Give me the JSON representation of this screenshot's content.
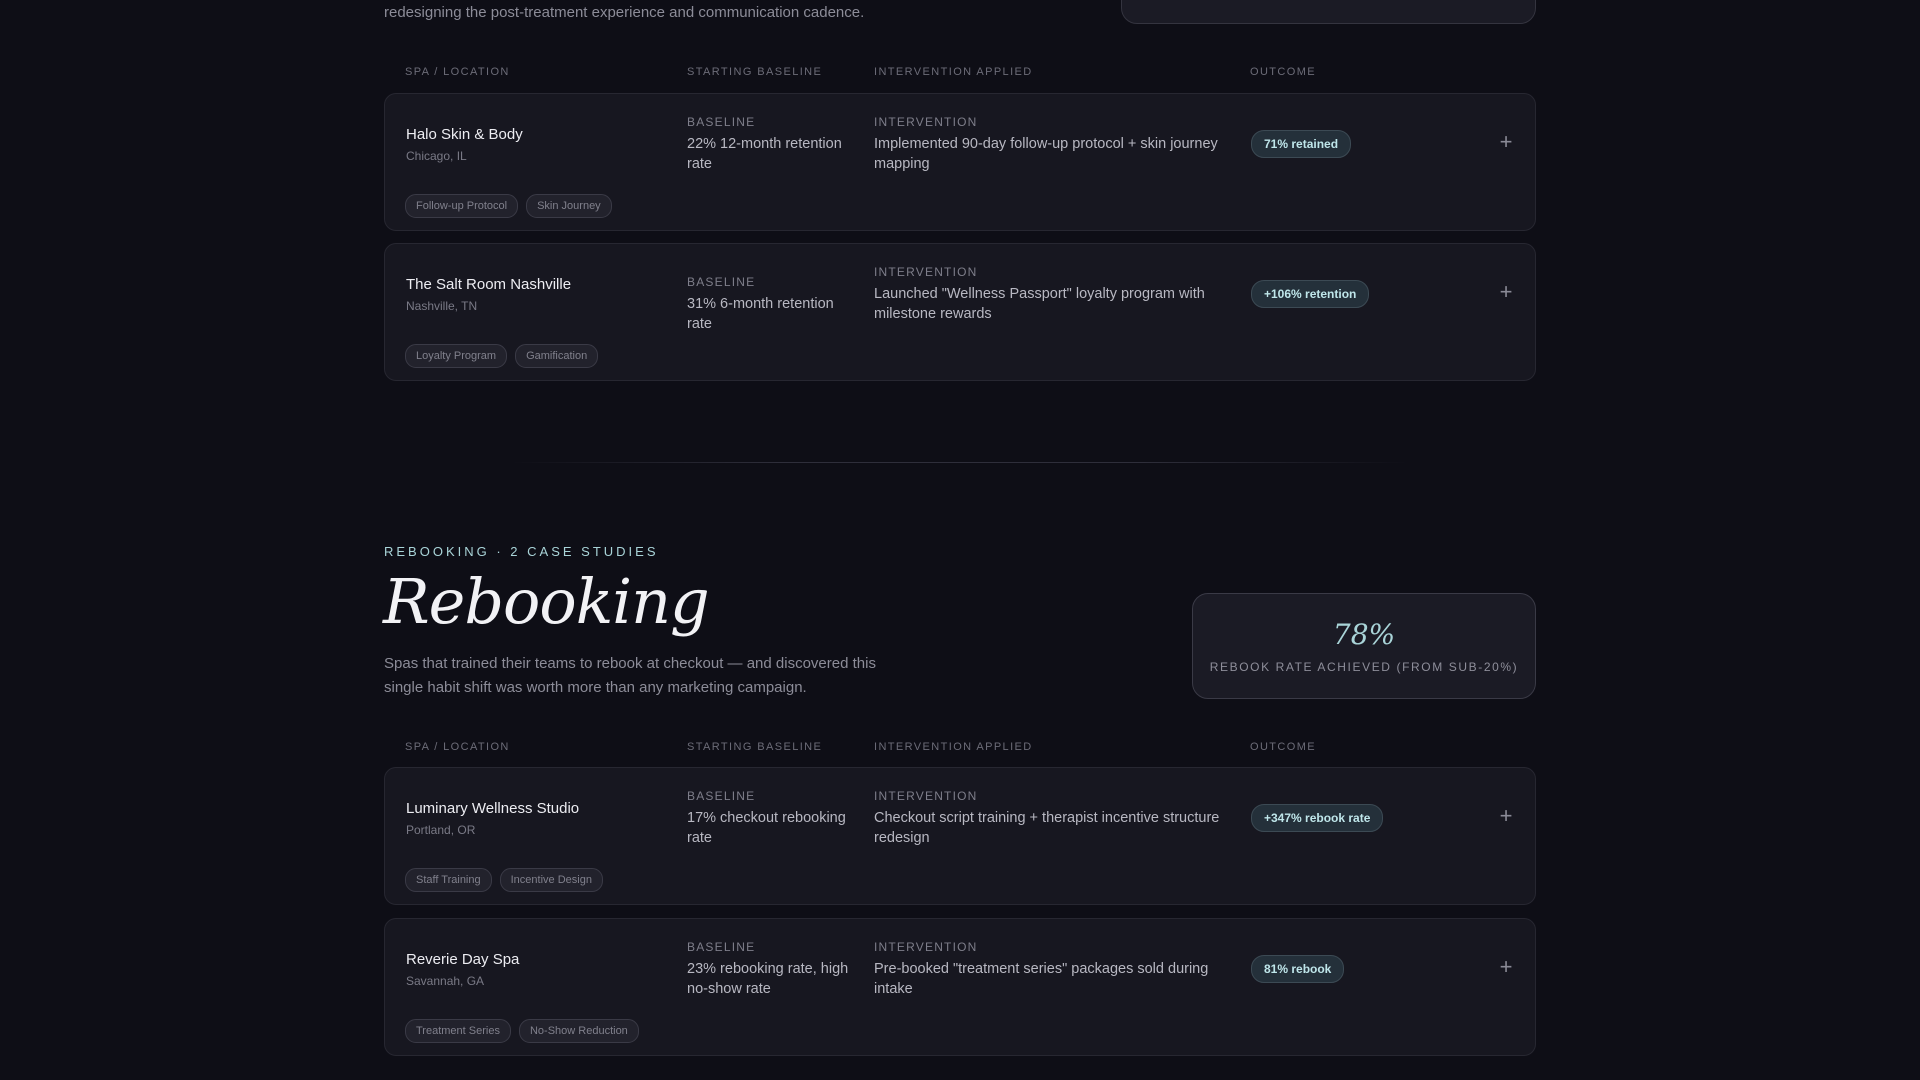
{
  "retention_section": {
    "description_tail": "redesigning the post-treatment experience and communication cadence.",
    "columns": [
      "SPA / LOCATION",
      "STARTING BASELINE",
      "INTERVENTION APPLIED",
      "OUTCOME"
    ],
    "rows": [
      {
        "name": "Halo Skin & Body",
        "location": "Chicago, IL",
        "baseline_label": "BASELINE",
        "baseline": "22% 12-month retention rate",
        "intervention_label": "INTERVENTION",
        "intervention": "Implemented 90-day follow-up protocol + skin journey mapping",
        "outcome": "71% retained",
        "tags": [
          "Follow-up Protocol",
          "Skin Journey"
        ]
      },
      {
        "name": "The Salt Room Nashville",
        "location": "Nashville, TN",
        "baseline_label": "BASELINE",
        "baseline": "31% 6-month retention rate",
        "intervention_label": "INTERVENTION",
        "intervention": "Launched \"Wellness Passport\" loyalty program with milestone rewards",
        "outcome": "+106% retention",
        "tags": [
          "Loyalty Program",
          "Gamification"
        ]
      }
    ]
  },
  "rebooking_section": {
    "eyebrow": "REBOOKING · 2 CASE STUDIES",
    "title": "Rebooking",
    "description": "Spas that trained their teams to rebook at checkout — and discovered this single habit shift was worth more than any marketing campaign.",
    "stat": {
      "value": "78%",
      "label": "REBOOK RATE ACHIEVED (FROM SUB-20%)"
    },
    "columns": [
      "SPA / LOCATION",
      "STARTING BASELINE",
      "INTERVENTION APPLIED",
      "OUTCOME"
    ],
    "rows": [
      {
        "name": "Luminary Wellness Studio",
        "location": "Portland, OR",
        "baseline_label": "BASELINE",
        "baseline": "17% checkout rebooking rate",
        "intervention_label": "INTERVENTION",
        "intervention": "Checkout script training + therapist incentive structure redesign",
        "outcome": "+347% rebook rate",
        "tags": [
          "Staff Training",
          "Incentive Design"
        ]
      },
      {
        "name": "Reverie Day Spa",
        "location": "Savannah, GA",
        "baseline_label": "BASELINE",
        "baseline": "23% rebooking rate, high no-show rate",
        "intervention_label": "INTERVENTION",
        "intervention": "Pre-booked \"treatment series\" packages sold during intake",
        "outcome": "81% rebook",
        "tags": [
          "Treatment Series",
          "No-Show Reduction"
        ]
      }
    ]
  },
  "icons": {
    "expand": "plus-icon"
  },
  "colors": {
    "background": "#0e0e16",
    "accent": "#a9d4d8",
    "card": "#171720"
  }
}
